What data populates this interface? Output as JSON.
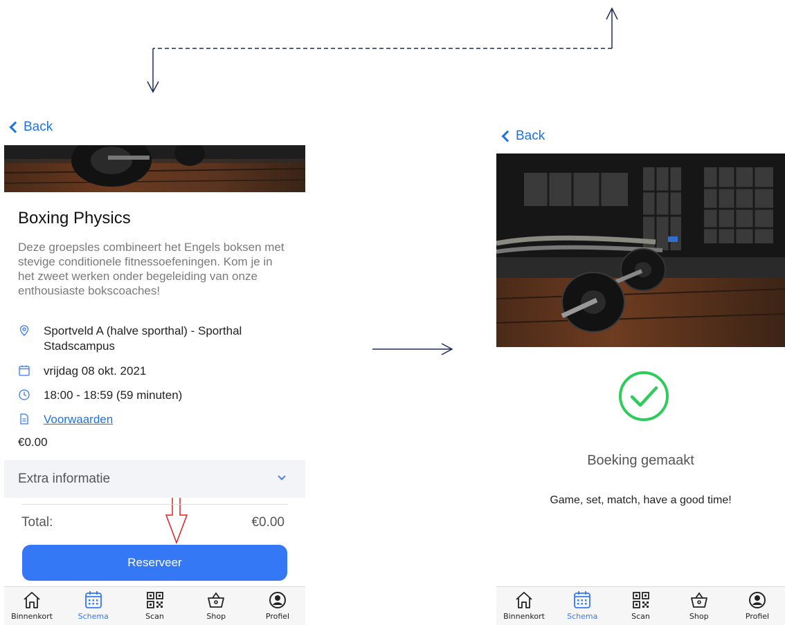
{
  "colors": {
    "accent": "#3478f6",
    "link": "#1a73e8",
    "success": "#2ecc5a",
    "arrow_navy": "#1b2a5a",
    "arrow_red": "#e02020"
  },
  "left_screen": {
    "back_label": "Back",
    "title": "Boxing Physics",
    "description": "Deze groepsles combineert het Engels boksen met stevige conditionele fitnessoefeningen. Kom je in het zweet werken onder begeleiding van onze enthousiaste bokscoaches!",
    "location": "Sportveld A (halve sporthal) - Sporthal Stadscampus",
    "date": "vrijdag 08 okt. 2021",
    "time": "18:00 - 18:59 (59 minuten)",
    "terms_link": "Voorwaarden",
    "price": "€0.00",
    "extra_info_label": "Extra informatie",
    "total_label": "Total:",
    "total_value": "€0.00",
    "reserve_button": "Reserveer"
  },
  "right_screen": {
    "back_label": "Back",
    "booked_title": "Boeking gemaakt",
    "booked_message": "Game, set, match, have a good time!"
  },
  "tabbar": {
    "items": [
      {
        "label": "Binnenkort",
        "icon": "home-icon",
        "active": false
      },
      {
        "label": "Schema",
        "icon": "calendar-icon",
        "active": true
      },
      {
        "label": "Scan",
        "icon": "qr-code-icon",
        "active": false
      },
      {
        "label": "Shop",
        "icon": "basket-icon",
        "active": false
      },
      {
        "label": "Profiel",
        "icon": "profile-icon",
        "active": false
      }
    ]
  }
}
